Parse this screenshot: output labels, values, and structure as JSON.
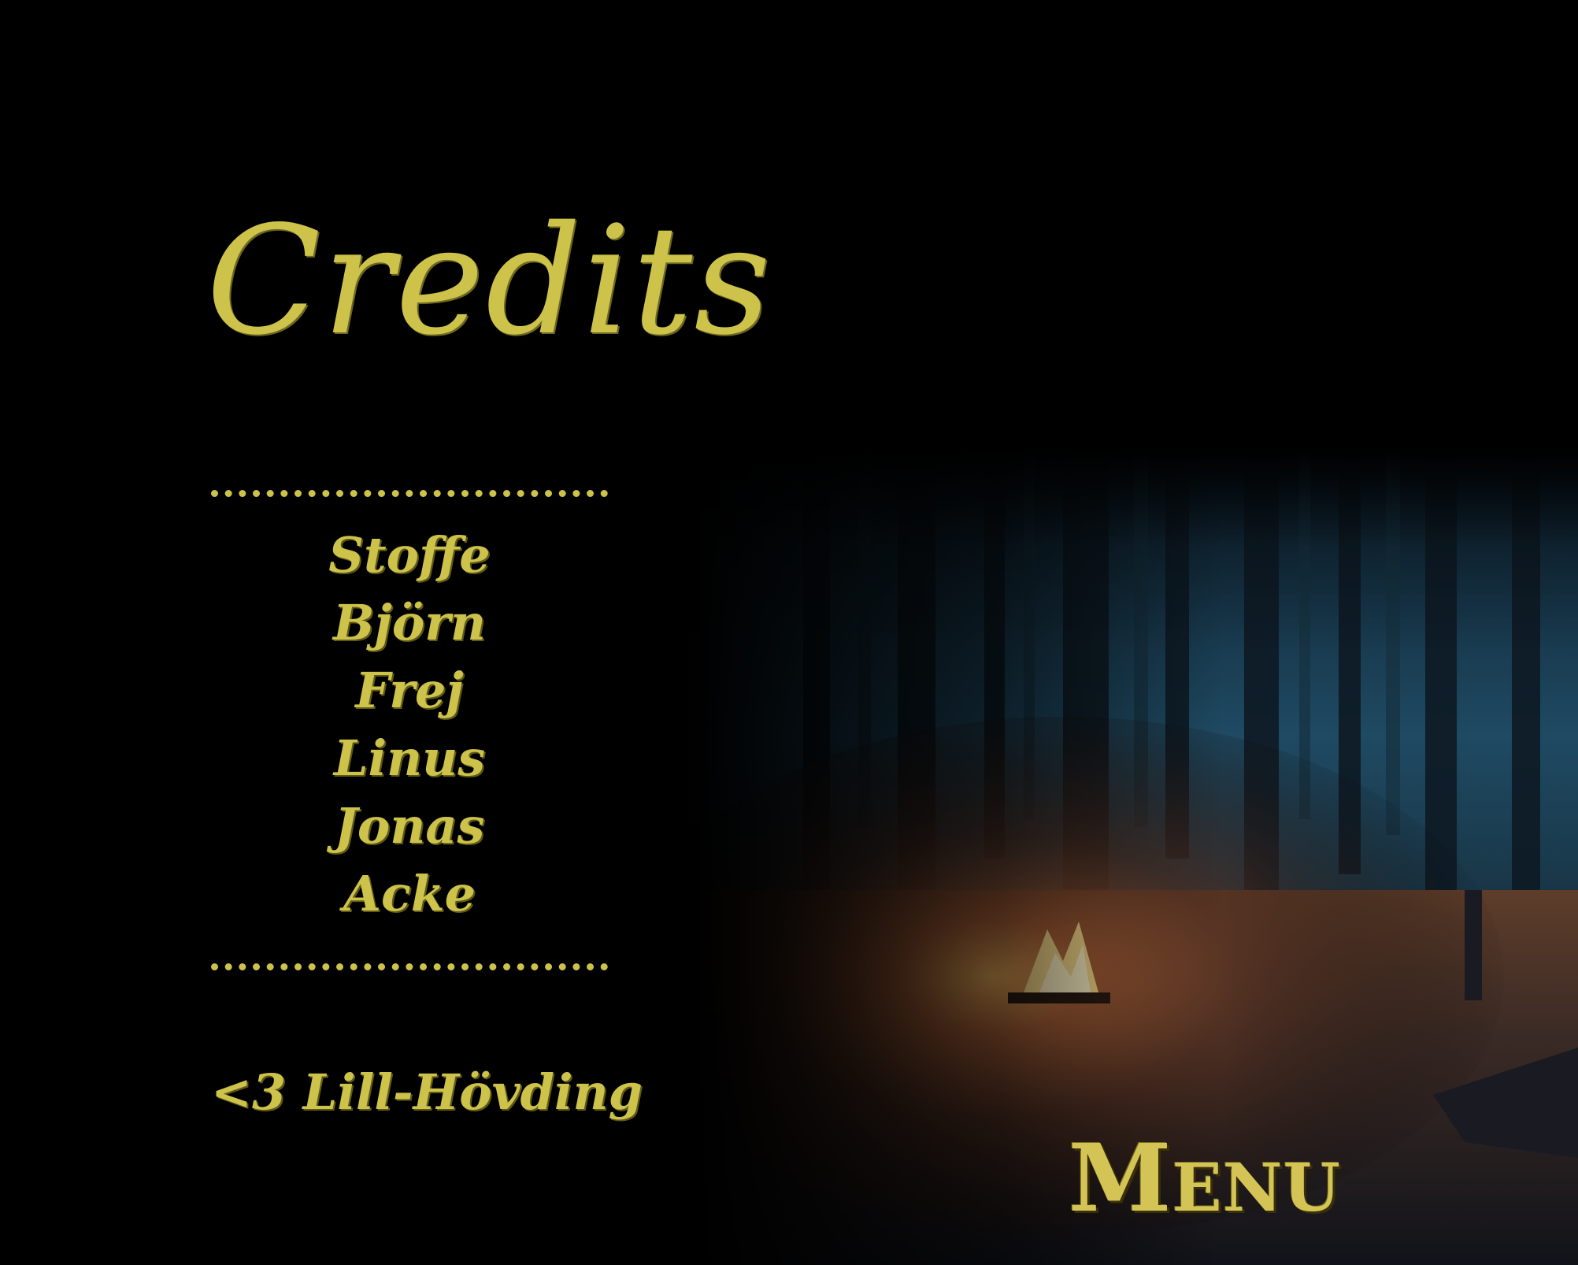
{
  "screen": {
    "title": "Credits",
    "names": [
      "Stoffe",
      "Björn",
      "Frej",
      "Linus",
      "Jonas",
      "Acke"
    ],
    "dedication": "<3 Lill-Hövding",
    "menu_label": "Menu"
  },
  "colors": {
    "text_gold": "#cdc24a",
    "background": "#000000"
  }
}
